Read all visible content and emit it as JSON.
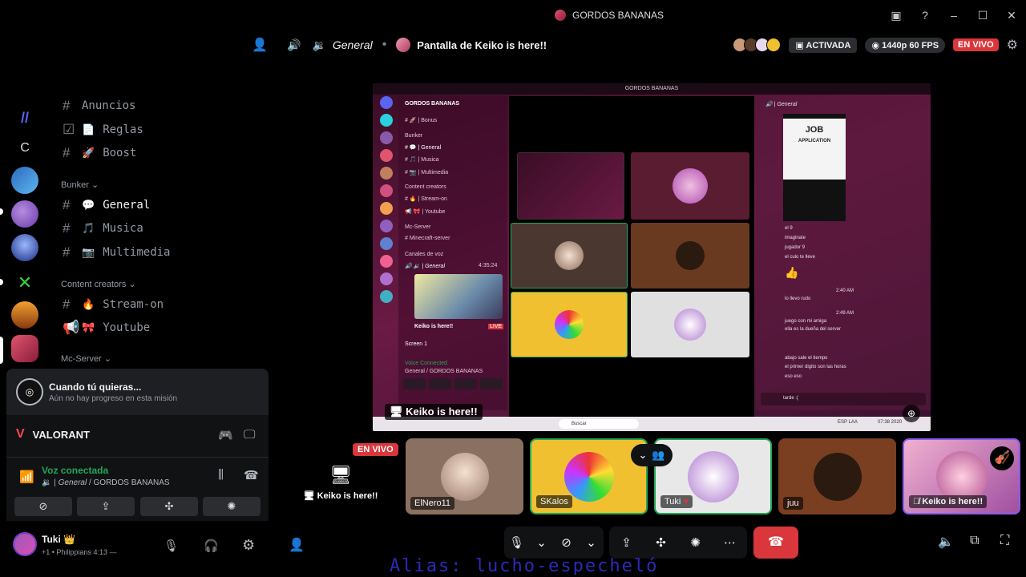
{
  "titlebar": {
    "server_name": "GORDOS BANANAS"
  },
  "header": {
    "channel": "General",
    "stream_title": "Pantalla de Keiko is here!!",
    "activated": "ACTIVADA",
    "quality": "1440p 60 FPS",
    "live": "EN VIVO"
  },
  "channels": {
    "top_partial": "Anuncios",
    "reglas": "Reglas",
    "boost": "Boost",
    "cat_bunker": "Bunker",
    "general": "General",
    "musica": "Musica",
    "multimedia": "Multimedia",
    "cat_content": "Content creators",
    "stream_on": "Stream-on",
    "youtube": "Youtube",
    "cat_mc": "Mc-Server"
  },
  "rail": {
    "letter_server": "C"
  },
  "stream": {
    "inner_title": "GORDOS BANANAS",
    "label": "Keiko is here!!",
    "inner_sidebar": {
      "server": "GORDOS BANANAS",
      "bonus": "Bonus",
      "bunker": "Bunker",
      "general": "General",
      "musica": "Musica",
      "multimedia": "Multimedia",
      "content": "Content creators",
      "stream_on": "Stream-on",
      "youtube": "Youtube",
      "mc": "Mc-Server",
      "minecraft": "Minecraft-server",
      "voice_cat": "Canales de voz",
      "general_voice": "General",
      "time": "4:35:24",
      "keiko": "Keiko is here!!",
      "live": "LIVE",
      "screen": "Screen 1",
      "voice_connected": "Voice Connected",
      "voice_path": "General / GORDOS BANANAS"
    },
    "inner_chat": {
      "channel": "General",
      "job1": "JOB",
      "job2": "APPLICATION",
      "l1": "el 9",
      "l2": "imaginate",
      "l3": "jugador 9",
      "l4": "el culo te lleve",
      "l5": "lo llevo rudo",
      "l6": "juego con mi amiga",
      "l7": "ella es la dueña del server",
      "l8": "abajo sale el tiempo",
      "l9": "el primer digito son las horas",
      "l10": "eso eso",
      "input": "tarde :(",
      "t1": "2:40 AM",
      "t2": "2:49 AM",
      "clock": "07:38 2020",
      "search": "Buscar",
      "esp": "ESP LAA"
    }
  },
  "participants": {
    "live": "EN VIVO",
    "screen_label": "Keiko is here!!",
    "tiles": [
      {
        "name": "ElNero11"
      },
      {
        "name": "SKalos"
      },
      {
        "name": "Tuki"
      },
      {
        "name": "juu"
      },
      {
        "name": "Keiko is here!!"
      }
    ]
  },
  "mission": {
    "title": "Cuando tú quieras...",
    "subtitle": "Aún no hay progreso en esta misión"
  },
  "panel": {
    "game": "VALORANT",
    "voice_status": "Voz conectada",
    "voice_path_channel": "General",
    "voice_path_server": "GORDOS BANANAS"
  },
  "user": {
    "name": "Tuki",
    "status": "+1 • Philippians 4:13 —"
  },
  "watermark": "Alias: lucho-especheló",
  "colors": {
    "accent_green": "#23a55a",
    "live_red": "#da373c",
    "bg": "#000000"
  }
}
